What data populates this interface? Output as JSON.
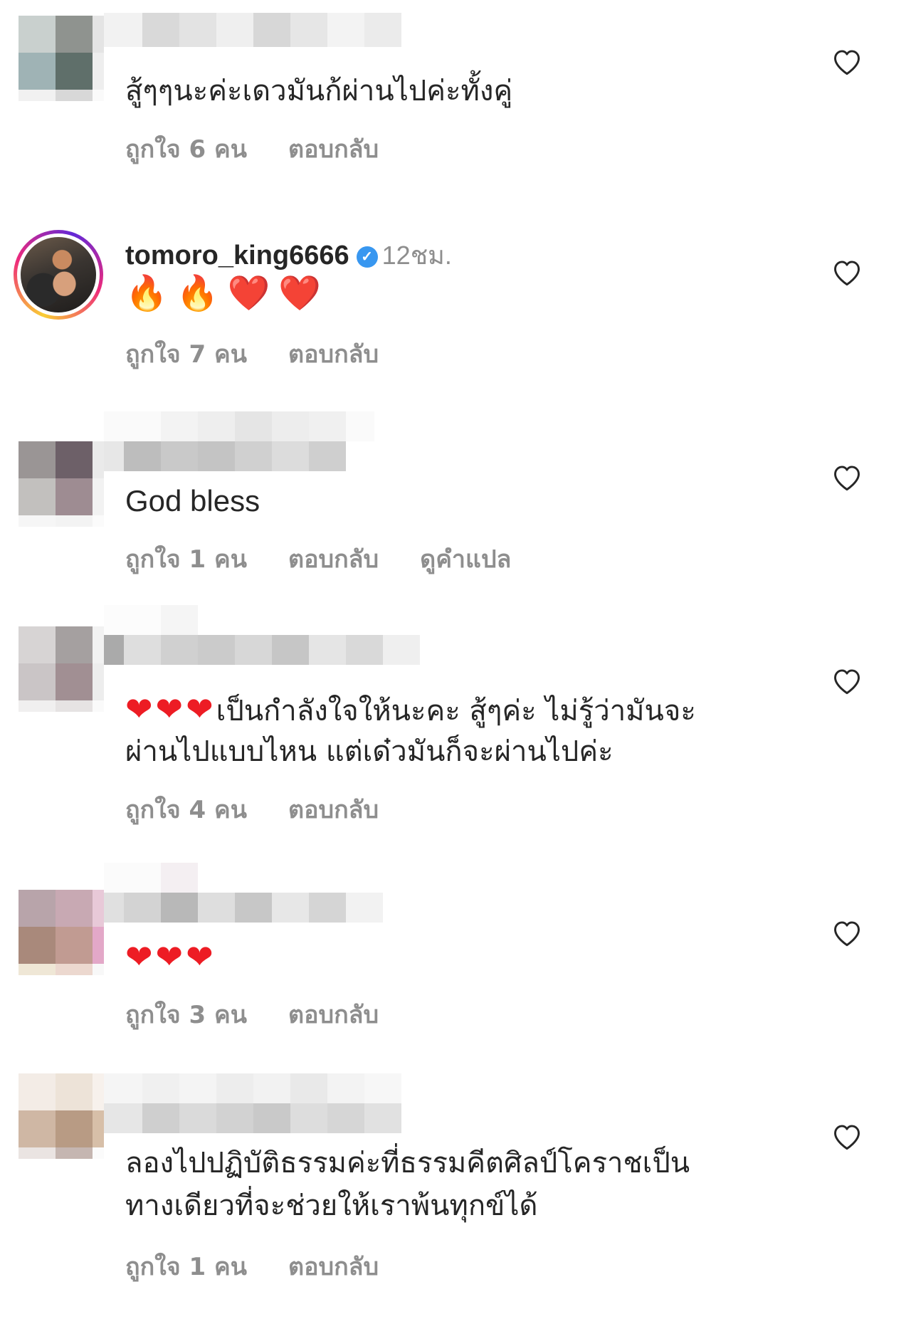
{
  "colors": {
    "text": "#262626",
    "secondary": "#8e8e8e",
    "verified": "#3897f0",
    "heart": "#ed1c24"
  },
  "comments": [
    {
      "text": "สู้ๆๆนะค่ะเดวมันก้ผ่านไปค่ะทั้งคู่",
      "likes": "ถูกใจ 6 คน",
      "reply": "ตอบกลับ"
    },
    {
      "username": "tomoro_king6666",
      "verified": true,
      "time": "12ชม.",
      "emoji": [
        "🔥",
        "🔥",
        "❤️",
        "❤️"
      ],
      "likes": "ถูกใจ 7 คน",
      "reply": "ตอบกลับ"
    },
    {
      "text": "God bless",
      "likes": "ถูกใจ 1 คน",
      "reply": "ตอบกลับ",
      "translate": "ดูคำแปล"
    },
    {
      "hearts": "❤❤❤",
      "text_line1": "เป็นกำลังใจให้นะคะ สู้ๆค่ะ ไม่รู้ว่ามันจะ",
      "text_line2": "ผ่านไปแบบไหน แต่เด๋วมันก็จะผ่านไปค่ะ",
      "likes": "ถูกใจ 4 คน",
      "reply": "ตอบกลับ"
    },
    {
      "hearts": "❤❤❤",
      "likes": "ถูกใจ 3 คน",
      "reply": "ตอบกลับ"
    },
    {
      "text_line1": "ลองไปปฏิบัติธรรมค่ะที่ธรรมคีตศิลป์โคราชเป็น",
      "text_line2": "ทางเดียวที่จะช่วยให้เราพ้นทุกข์ได้",
      "likes": "ถูกใจ 1 คน",
      "reply": "ตอบกลับ"
    }
  ]
}
